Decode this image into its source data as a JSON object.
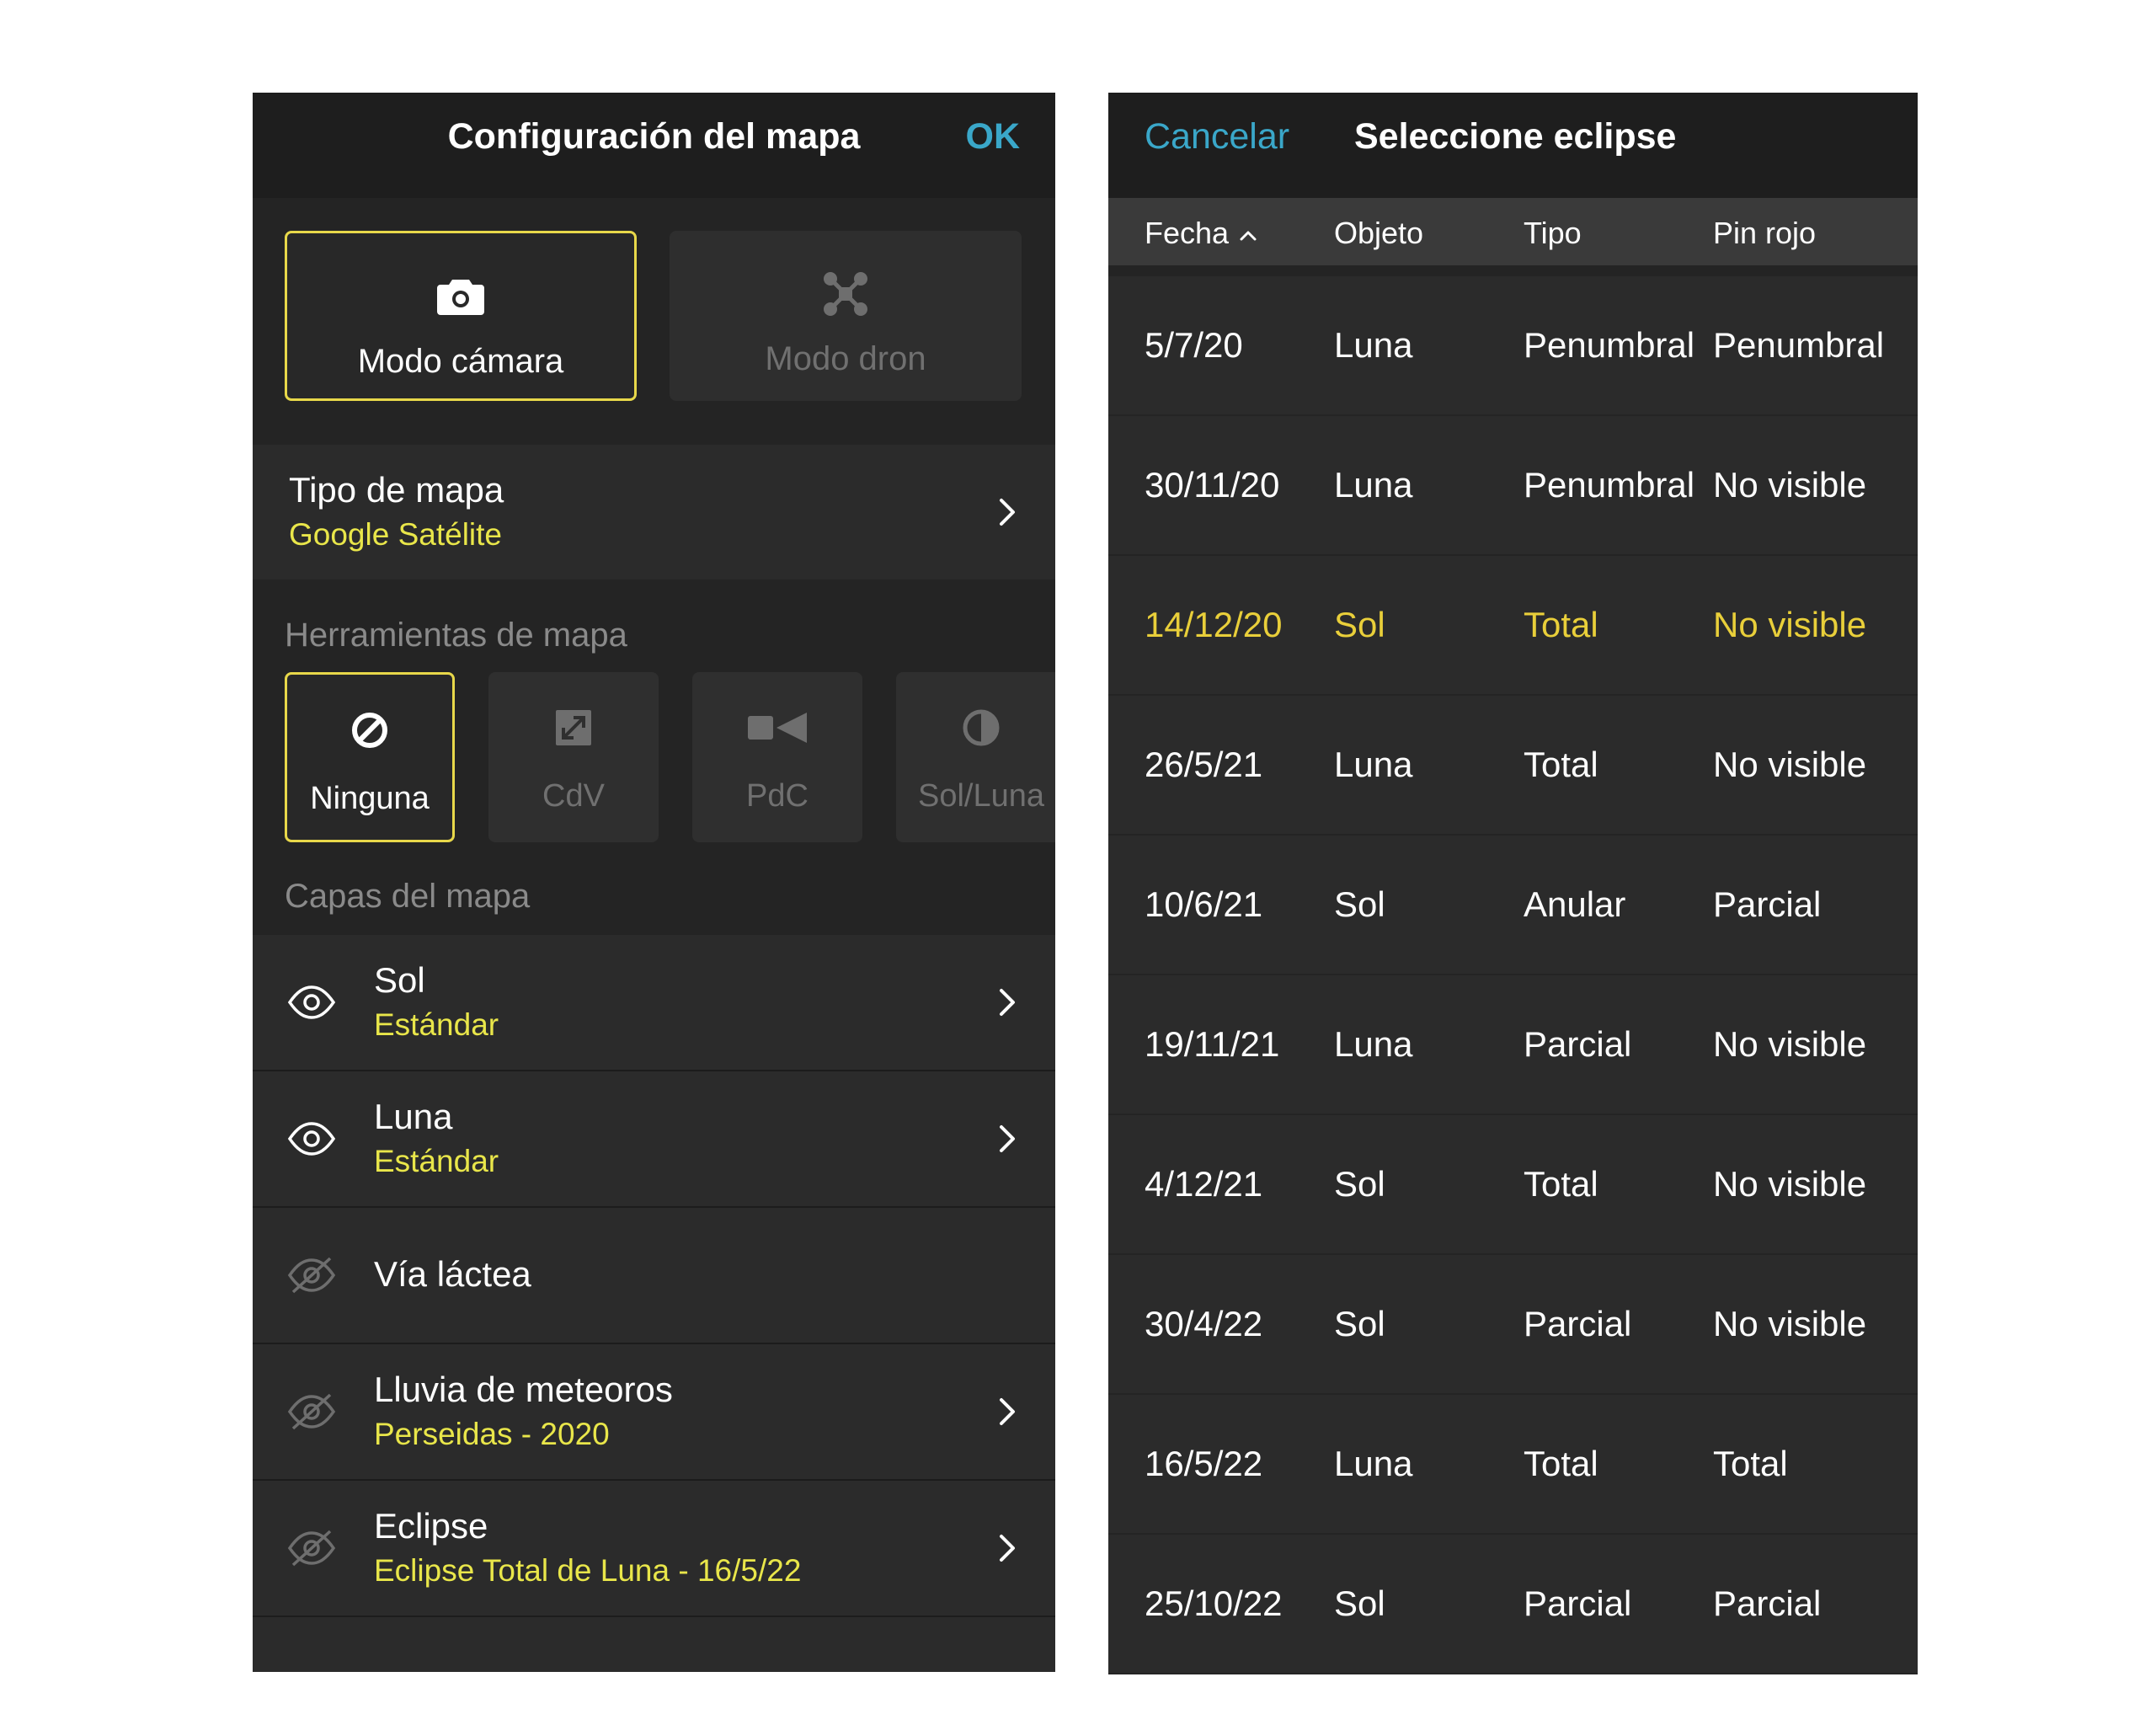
{
  "left_panel": {
    "title": "Configuración del mapa",
    "ok_label": "OK",
    "modes": [
      {
        "label": "Modo cámara",
        "icon": "camera-icon",
        "selected": true
      },
      {
        "label": "Modo dron",
        "icon": "drone-icon",
        "selected": false
      }
    ],
    "map_type": {
      "label": "Tipo de mapa",
      "value": "Google Satélite"
    },
    "tools_heading": "Herramientas de mapa",
    "tools": [
      {
        "label": "Ninguna",
        "icon": "none-icon",
        "selected": true
      },
      {
        "label": "CdV",
        "icon": "field-of-view-icon",
        "selected": false
      },
      {
        "label": "PdC",
        "icon": "video-camera-icon",
        "selected": false
      },
      {
        "label": "Sol/Luna",
        "icon": "half-circle-icon",
        "selected": false
      }
    ],
    "layers_heading": "Capas del mapa",
    "layers": [
      {
        "label": "Sol",
        "value": "Estándar",
        "visible": true
      },
      {
        "label": "Luna",
        "value": "Estándar",
        "visible": true
      },
      {
        "label": "Vía láctea",
        "value": "",
        "visible": false
      },
      {
        "label": "Lluvia de meteoros",
        "value": "Perseidas - 2020",
        "visible": false
      },
      {
        "label": "Eclipse",
        "value": "Eclipse Total de Luna - 16/5/22",
        "visible": false
      }
    ]
  },
  "right_panel": {
    "cancel_label": "Cancelar",
    "title": "Seleccione eclipse",
    "columns": {
      "fecha": "Fecha",
      "objeto": "Objeto",
      "tipo": "Tipo",
      "pin": "Pin rojo"
    },
    "rows": [
      {
        "fecha": "5/7/20",
        "objeto": "Luna",
        "tipo": "Penumbral",
        "pin": "Penumbral",
        "highlight": false
      },
      {
        "fecha": "30/11/20",
        "objeto": "Luna",
        "tipo": "Penumbral",
        "pin": "No visible",
        "highlight": false
      },
      {
        "fecha": "14/12/20",
        "objeto": "Sol",
        "tipo": "Total",
        "pin": "No visible",
        "highlight": true
      },
      {
        "fecha": "26/5/21",
        "objeto": "Luna",
        "tipo": "Total",
        "pin": "No visible",
        "highlight": false
      },
      {
        "fecha": "10/6/21",
        "objeto": "Sol",
        "tipo": "Anular",
        "pin": "Parcial",
        "highlight": false
      },
      {
        "fecha": "19/11/21",
        "objeto": "Luna",
        "tipo": "Parcial",
        "pin": "No visible",
        "highlight": false
      },
      {
        "fecha": "4/12/21",
        "objeto": "Sol",
        "tipo": "Total",
        "pin": "No visible",
        "highlight": false
      },
      {
        "fecha": "30/4/22",
        "objeto": "Sol",
        "tipo": "Parcial",
        "pin": "No visible",
        "highlight": false
      },
      {
        "fecha": "16/5/22",
        "objeto": "Luna",
        "tipo": "Total",
        "pin": "Total",
        "highlight": false
      },
      {
        "fecha": "25/10/22",
        "objeto": "Sol",
        "tipo": "Parcial",
        "pin": "Parcial",
        "highlight": false
      }
    ]
  },
  "colors": {
    "accent_yellow": "#e9e64a",
    "link_blue": "#3aa7c9",
    "panel_bg": "#242424"
  }
}
